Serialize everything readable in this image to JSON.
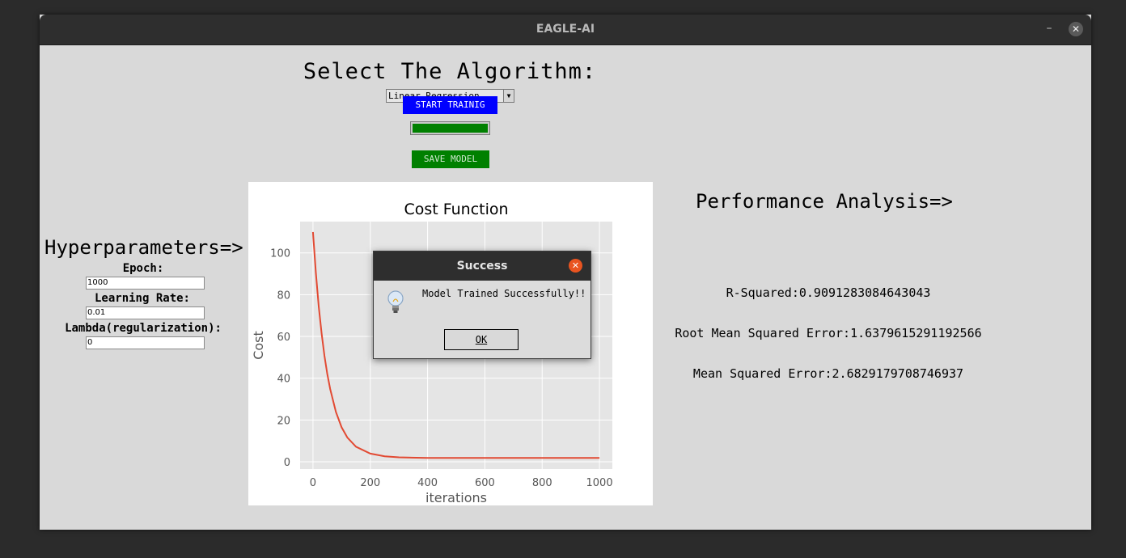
{
  "window": {
    "title": "EAGLE-AI",
    "minimize_icon": "minimize-icon",
    "close_icon": "close-icon"
  },
  "algorithm": {
    "heading": "Select The Algorithm:",
    "selected": "Linear Regression",
    "start_button": "START TRAINIG",
    "progress_fraction": 1.0,
    "save_button": "SAVE MODEL"
  },
  "hyperparameters": {
    "heading": "Hyperparameters=>",
    "epoch_label": "Epoch:",
    "epoch_value": "1000",
    "learning_rate_label": "Learning Rate:",
    "learning_rate_value": "0.01",
    "lambda_label": "Lambda(regularization):",
    "lambda_value": "0"
  },
  "performance": {
    "heading": "Performance Analysis=>",
    "r_squared": "R-Squared:0.9091283084643043",
    "rmse": "Root Mean Squared Error:1.6379615291192566",
    "mse": "Mean Squared Error:2.6829179708746937"
  },
  "dialog": {
    "title": "Success",
    "message": "Model Trained Successfully!!",
    "ok_button": "OK",
    "close_icon": "close-icon",
    "info_icon": "lightbulb-icon"
  },
  "colors": {
    "start_button": "#0000ff",
    "save_button": "#008000",
    "progress_fill": "#008000",
    "curve": "#e24a33",
    "dialog_close": "#e95420"
  },
  "chart_data": {
    "type": "line",
    "title": "Cost Function",
    "xlabel": "iterations",
    "ylabel": "Cost",
    "xlim": [
      -45,
      1045
    ],
    "ylim": [
      -3.5,
      115
    ],
    "xticks": [
      0,
      200,
      400,
      600,
      800,
      1000
    ],
    "yticks": [
      0,
      20,
      40,
      60,
      80,
      100
    ],
    "grid": true,
    "style": "ggplot",
    "series": [
      {
        "x": [
          0,
          10,
          20,
          30,
          40,
          50,
          60,
          80,
          100,
          120,
          150,
          200,
          250,
          300,
          400,
          500,
          600,
          700,
          800,
          900,
          1000
        ],
        "values": [
          110,
          90.4,
          74.4,
          61.4,
          50.7,
          42.0,
          34.8,
          23.8,
          16.5,
          11.6,
          7.2,
          3.9,
          2.6,
          2.1,
          1.8,
          1.8,
          1.8,
          1.8,
          1.8,
          1.8,
          1.8
        ]
      }
    ]
  }
}
